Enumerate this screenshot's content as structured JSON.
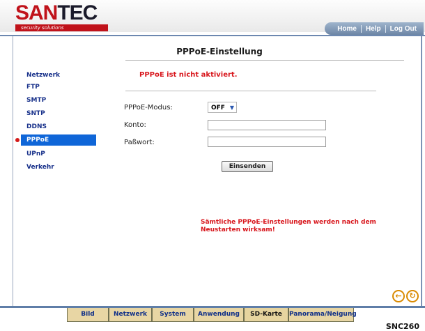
{
  "header": {
    "logo_red": "SAN",
    "logo_dark": "TEC",
    "logo_sub": "security solutions",
    "nav": [
      "Home",
      "Help",
      "Log Out"
    ]
  },
  "page": {
    "title": "PPPoE-Einstellung",
    "status": "PPPoE ist nicht aktiviert.",
    "fields": {
      "mode_label": "PPPoE-Modus:",
      "mode_value": "OFF",
      "account_label": "Konto:",
      "account_value": "",
      "password_label": "Paßwort:",
      "password_value": ""
    },
    "submit_label": "Einsenden",
    "note": "Sämtliche PPPoE-Einstellungen werden nach dem Neustarten wirksam!"
  },
  "sidebar": {
    "items": [
      {
        "label": "Netzwerk"
      },
      {
        "label": "FTP"
      },
      {
        "label": "SMTP"
      },
      {
        "label": "SNTP"
      },
      {
        "label": "DDNS"
      },
      {
        "label": "PPPoE",
        "active": true
      },
      {
        "label": "UPnP"
      },
      {
        "label": "Verkehr"
      }
    ]
  },
  "icons": {
    "back": "back-arrow-icon",
    "refresh": "refresh-icon"
  },
  "tabs": [
    "Bild",
    "Netzwerk",
    "System",
    "Anwendung",
    "SD-Karte",
    "Panorama/Neigung"
  ],
  "model": "SNC260"
}
